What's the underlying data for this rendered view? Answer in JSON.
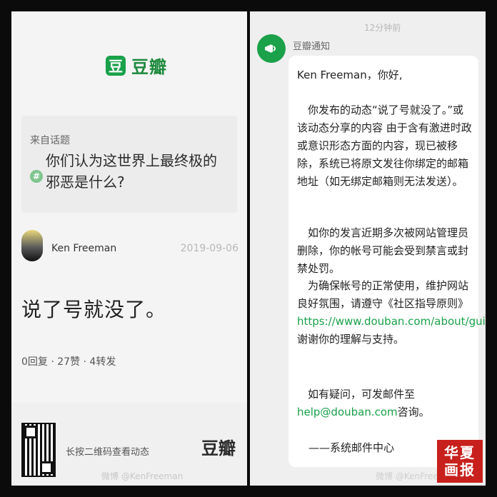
{
  "left": {
    "logo_mark": "豆",
    "logo_text": "豆瓣",
    "topic": {
      "from_label": "来自话题",
      "hash": "#",
      "title": "你们认为这世界上最终极的邪恶是什么?"
    },
    "author": {
      "name": "Ken Freeman",
      "date": "2019-09-06"
    },
    "post_text": "说了号就没了。",
    "stats": "0回复 · 27赞 · 4转发",
    "share": {
      "hint": "长按二维码查看动态",
      "logo": "豆瓣"
    },
    "watermark": "微博 @KenFreeman"
  },
  "right": {
    "timestamp": "12分钟前",
    "notice_from": "豆瓣通知",
    "message": {
      "greeting": "Ken Freeman，你好,",
      "p1": "你发布的动态“说了号就没了。”或该动态分享的内容 由于含有激进时政或意识形态方面的内容，现已被移除，系统已将原文发往你绑定的邮箱地址（如无绑定邮箱则无法发送）。",
      "p2": "如你的发言近期多次被网站管理员删除，你的帐号可能会受到禁言或封禁处罚。",
      "p3_before": "为确保帐号的正常使用，维护网站良好氛围，请遵守《社区指导原则》",
      "p3_link": "https://www.douban.com/about/guideline",
      "p3_after": "，谢谢你的理解与支持。",
      "p4_before": "如有疑问，可发邮件至",
      "p4_link": "help@douban.com",
      "p4_after": "咨询。",
      "signature": "——系统邮件中心"
    },
    "watermark": "微博 @KenFreeman"
  },
  "stamp": {
    "line1": "华夏",
    "line2": "画报"
  },
  "colors": {
    "brand_green": "#1aa14a",
    "link_green": "#1aa14a",
    "stamp_red": "#c8201c"
  }
}
